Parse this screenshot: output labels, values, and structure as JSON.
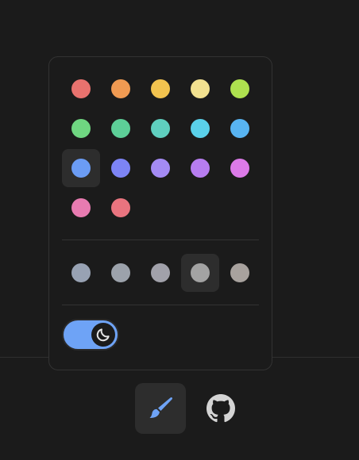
{
  "theme_picker": {
    "accent_palette": [
      {
        "name": "red",
        "color": "#e8726e"
      },
      {
        "name": "orange",
        "color": "#f09a52"
      },
      {
        "name": "amber",
        "color": "#f2c34f"
      },
      {
        "name": "yellow",
        "color": "#f2e190"
      },
      {
        "name": "lime",
        "color": "#aee14f"
      },
      {
        "name": "green",
        "color": "#6fd681"
      },
      {
        "name": "emerald",
        "color": "#5dcf98"
      },
      {
        "name": "teal",
        "color": "#5fcfbf"
      },
      {
        "name": "cyan",
        "color": "#5ad1ea"
      },
      {
        "name": "sky",
        "color": "#58b4f2"
      },
      {
        "name": "blue",
        "color": "#6b9cf4",
        "selected": true
      },
      {
        "name": "indigo",
        "color": "#7d84f5"
      },
      {
        "name": "violet",
        "color": "#a48bf4"
      },
      {
        "name": "purple",
        "color": "#b77df0"
      },
      {
        "name": "fuchsia",
        "color": "#dc7ae8"
      },
      {
        "name": "pink",
        "color": "#e87bb1"
      },
      {
        "name": "rose",
        "color": "#e9747f"
      }
    ],
    "gray_palette": [
      {
        "name": "slate",
        "color": "#98a2b3"
      },
      {
        "name": "gray",
        "color": "#9ca2ab"
      },
      {
        "name": "zinc",
        "color": "#a1a1aa"
      },
      {
        "name": "neutral",
        "color": "#a3a3a3",
        "selected": true
      },
      {
        "name": "stone",
        "color": "#a8a29e"
      }
    ],
    "dark_mode_toggle": {
      "on": true,
      "color": "#6ea3f6",
      "icon": "moon-icon"
    }
  },
  "footer": {
    "theme_button": {
      "icon": "paintbrush-icon",
      "color": "#6ea3f6",
      "active": true
    },
    "github_button": {
      "icon": "github-icon",
      "color": "#d4d4d4"
    }
  },
  "colors": {
    "background": "#1b1b1b",
    "border": "#333333",
    "selected_bg": "#2d2d2d"
  }
}
